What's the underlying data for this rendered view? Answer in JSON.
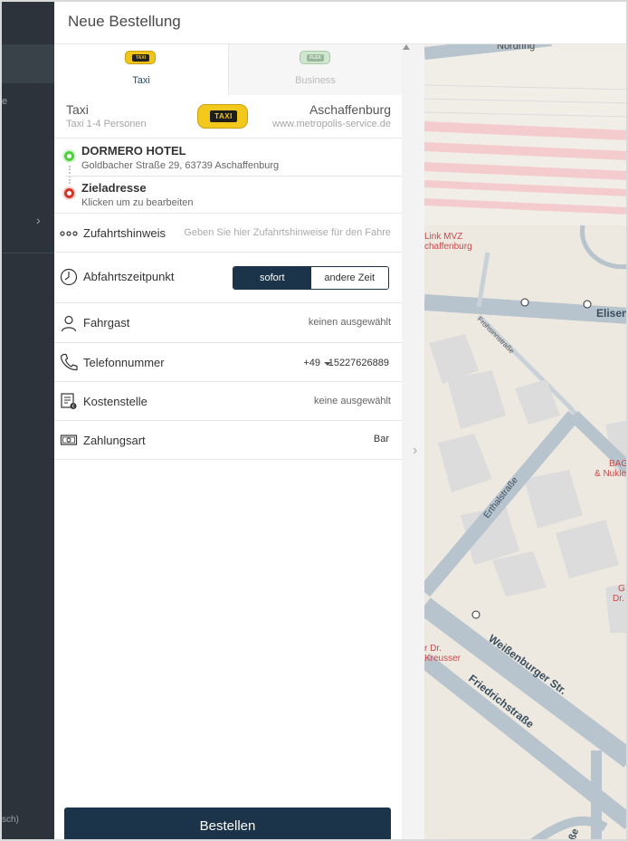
{
  "header": {
    "title": "Neue Bestellung"
  },
  "sidebar": {
    "text_fragment": "e",
    "footer_fragment": "sch)"
  },
  "tabs": [
    {
      "label": "Taxi",
      "badge": "TAXI",
      "active": true
    },
    {
      "label": "Business",
      "badge": "FLEX",
      "active": false
    }
  ],
  "vehicle": {
    "name": "Taxi",
    "subtitle": "Taxi 1-4 Personen",
    "badge": "TAXI",
    "city": "Aschaffenburg",
    "website": "www.metropolis-service.de"
  },
  "route": {
    "pickup_name": "DORMERO HOTEL",
    "pickup_address": "Goldbacher Straße 29, 63739 Aschaffenburg",
    "destination_label": "Zieladresse",
    "destination_hint": "Klicken um zu bearbeiten"
  },
  "fields": {
    "access_label": "Zufahrtshinweis",
    "access_placeholder": "Geben Sie hier Zufahrtshinweise für den Fahre",
    "departure_label": "Abfahrtszeitpunkt",
    "departure_now": "sofort",
    "departure_other": "andere Zeit",
    "passenger_label": "Fahrgast",
    "passenger_value": "keinen ausgewählt",
    "phone_label": "Telefonnummer",
    "phone_country_code": "+49",
    "phone_number": "15227626889",
    "cost_center_label": "Kostenstelle",
    "cost_center_value": "keine ausgewählt",
    "payment_label": "Zahlungsart",
    "payment_value": "Bar"
  },
  "order_button": "Bestellen",
  "map": {
    "labels": {
      "north_street": "Nordring",
      "poi1_line1": "Link MVZ",
      "poi1_line2": "chaffenburg",
      "elisen": "Elisen",
      "frohsinn": "Frohsinnstraße",
      "bag1": "BAG",
      "bag2": "& Nukle",
      "erthal": "Erthalstraße",
      "g1": "G",
      "g2": "Dr.",
      "kreusser1": "r Dr.",
      "kreusser2": "Kreusser",
      "weissenburger": "Weißenburger Str.",
      "friedrich": "Friedrichstraße",
      "bottom": "ße"
    },
    "colors": {
      "road": "#b7c3cd",
      "rail": "#f4cccd",
      "poi_text": "#c84a4a"
    }
  },
  "colors": {
    "primary": "#1b3449",
    "sidebar": "#2c333b",
    "pickup": "#4cd137",
    "destination": "#d9342b"
  }
}
